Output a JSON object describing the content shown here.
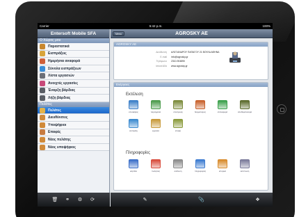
{
  "status_bar": {
    "carrier": "Carrier",
    "time": "5:42 p.m.",
    "battery": "100%"
  },
  "left_panel": {
    "title": "Entersoft Mobile SFA",
    "section_my_space": "Ο Χώρος μου",
    "my_items": [
      {
        "label": "Παραστατικά",
        "icon": "document-icon",
        "color": "#c8872e"
      },
      {
        "label": "Εισπράξεις",
        "icon": "coins-icon",
        "color": "#d8a43b"
      },
      {
        "label": "Ημερήσια αναφορά",
        "icon": "report-icon",
        "color": "#d0603a"
      },
      {
        "label": "Σύνολα εισπράξεων",
        "icon": "globe-icon",
        "color": "#3b8ed8"
      },
      {
        "label": "Λίστα εργασιών",
        "icon": "tasks-icon",
        "color": "#6b6f78"
      },
      {
        "label": "Ανοιχτές εργασίες",
        "icon": "open-tasks-icon",
        "color": "#c84a7a"
      },
      {
        "label": "Έναρξη βάρδιας",
        "icon": "shift-start-icon",
        "color": "#5a5e66"
      },
      {
        "label": "Λήξη βάρδιας",
        "icon": "shift-end-icon",
        "color": "#5a5e66"
      }
    ],
    "section_customers": "Πελάτες",
    "customer_items": [
      {
        "label": "Πελάτες",
        "icon": "customers-icon",
        "color": "#e2b24a",
        "selected": true
      },
      {
        "label": "Διευθύνσεις",
        "icon": "addresses-icon",
        "color": "#d08a3a",
        "selected": false
      },
      {
        "label": "Υποψήφιοι",
        "icon": "prospects-icon",
        "color": "#d08a3a",
        "selected": false
      },
      {
        "label": "Επαφές",
        "icon": "contacts-icon",
        "color": "#c77b40",
        "selected": false
      },
      {
        "label": "Νέος πελάτης",
        "icon": "new-customer-icon",
        "color": "#d08a3a",
        "selected": false
      },
      {
        "label": "Νέος υποψήφιος",
        "icon": "new-prospect-icon",
        "color": "#d08a3a",
        "selected": false
      }
    ],
    "toolbar": [
      "trash-icon",
      "link-icon",
      "settings-icon",
      "refresh-icon"
    ]
  },
  "right_panel": {
    "menu_button": "Menu",
    "company_name": "AGROSKY AE",
    "info_card": {
      "title": "AGROSKY AE",
      "rows": [
        {
          "key": "Διεύθυνση",
          "value": "ΑΛΕΞΑΝΔΡΟΥ ΠΑΠΑΓΟΥ 21 ΒΟΥΛΑ ΑΘΗΝΑ"
        },
        {
          "key": "E-mail",
          "value": "info@agrosky.gr"
        },
        {
          "key": "Τηλέφωνο",
          "value": "2310-904890"
        },
        {
          "key": "Ιστοσελίδα",
          "value": "www.agrosky.gr"
        }
      ]
    },
    "actions_card": {
      "title": "Ενέργειες",
      "group1_title": "Εκτέλεση",
      "group1": [
        {
          "label": "επισκέψεις",
          "icon": "clock-icon",
          "color": "#3a7ec8"
        },
        {
          "label": "παραγγελία",
          "icon": "order-icon",
          "color": "#4a9a4a"
        },
        {
          "label": "επιστροφή",
          "icon": "return-icon",
          "color": "#7a8a3a"
        },
        {
          "label": "δειγματισμός",
          "icon": "samples-icon",
          "color": "#c8602a"
        },
        {
          "label": "επαναφορά",
          "icon": "restore-icon",
          "color": "#3aa04a"
        },
        {
          "label": "αποθεματολογία",
          "icon": "inventory-icon",
          "color": "#5a6a2a"
        },
        {
          "label": "είσπραξη",
          "icon": "payment-icon",
          "color": "#3a8ad0"
        },
        {
          "label": "εργασία",
          "icon": "task-icon",
          "color": "#c89a3a"
        },
        {
          "label": "επαφή",
          "icon": "contact-icon",
          "color": "#8a9a3a"
        }
      ],
      "group2_title": "Πληροφορίες",
      "group2": [
        {
          "label": "καρτέλα",
          "icon": "card-icon",
          "color": "#3a6ec8"
        },
        {
          "label": "πωλήσεις",
          "icon": "pie-chart-icon",
          "color": "#d84a3a"
        },
        {
          "label": "ανάλυση",
          "icon": "analysis-icon",
          "color": "#8a8a8a"
        },
        {
          "label": "πληροφορίες",
          "icon": "info-icon",
          "color": "#3a7ad0"
        },
        {
          "label": "ιστορικό",
          "icon": "history-icon",
          "color": "#d88a2a"
        },
        {
          "label": "εκτύπωση",
          "icon": "print-icon",
          "color": "#7a7a9a"
        }
      ]
    },
    "toolbar": [
      "edit-icon",
      "attach-icon",
      "dropbox-icon"
    ]
  }
}
